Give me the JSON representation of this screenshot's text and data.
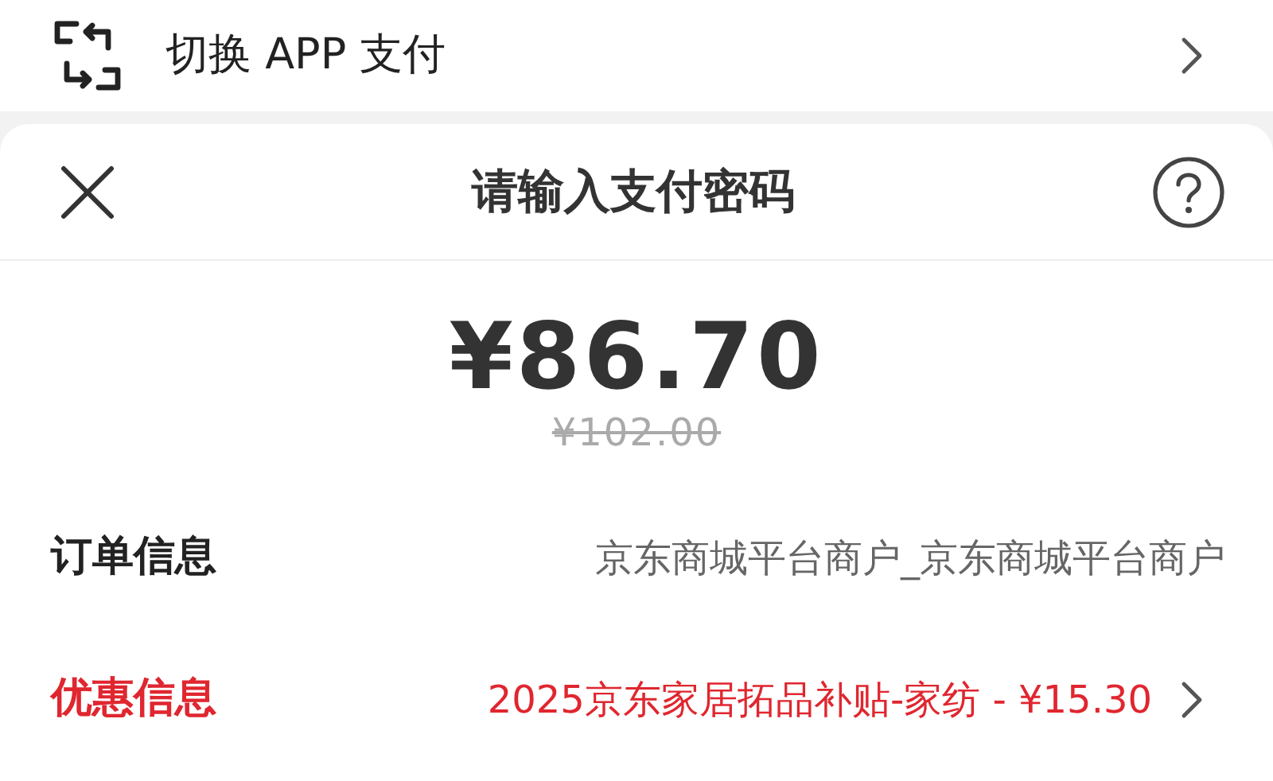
{
  "switch_option": {
    "label": "切换 APP 支付"
  },
  "sheet": {
    "title": "请输入支付密码",
    "amount": "¥86.70",
    "original_amount": "¥102.00",
    "rows": [
      {
        "kind": "info",
        "label": "订单信息",
        "value": "京东商城平台商户_京东商城平台商户"
      },
      {
        "kind": "discount",
        "label": "优惠信息",
        "value": "2025京东家居拓品补贴-家纺 - ¥15.30"
      }
    ]
  }
}
